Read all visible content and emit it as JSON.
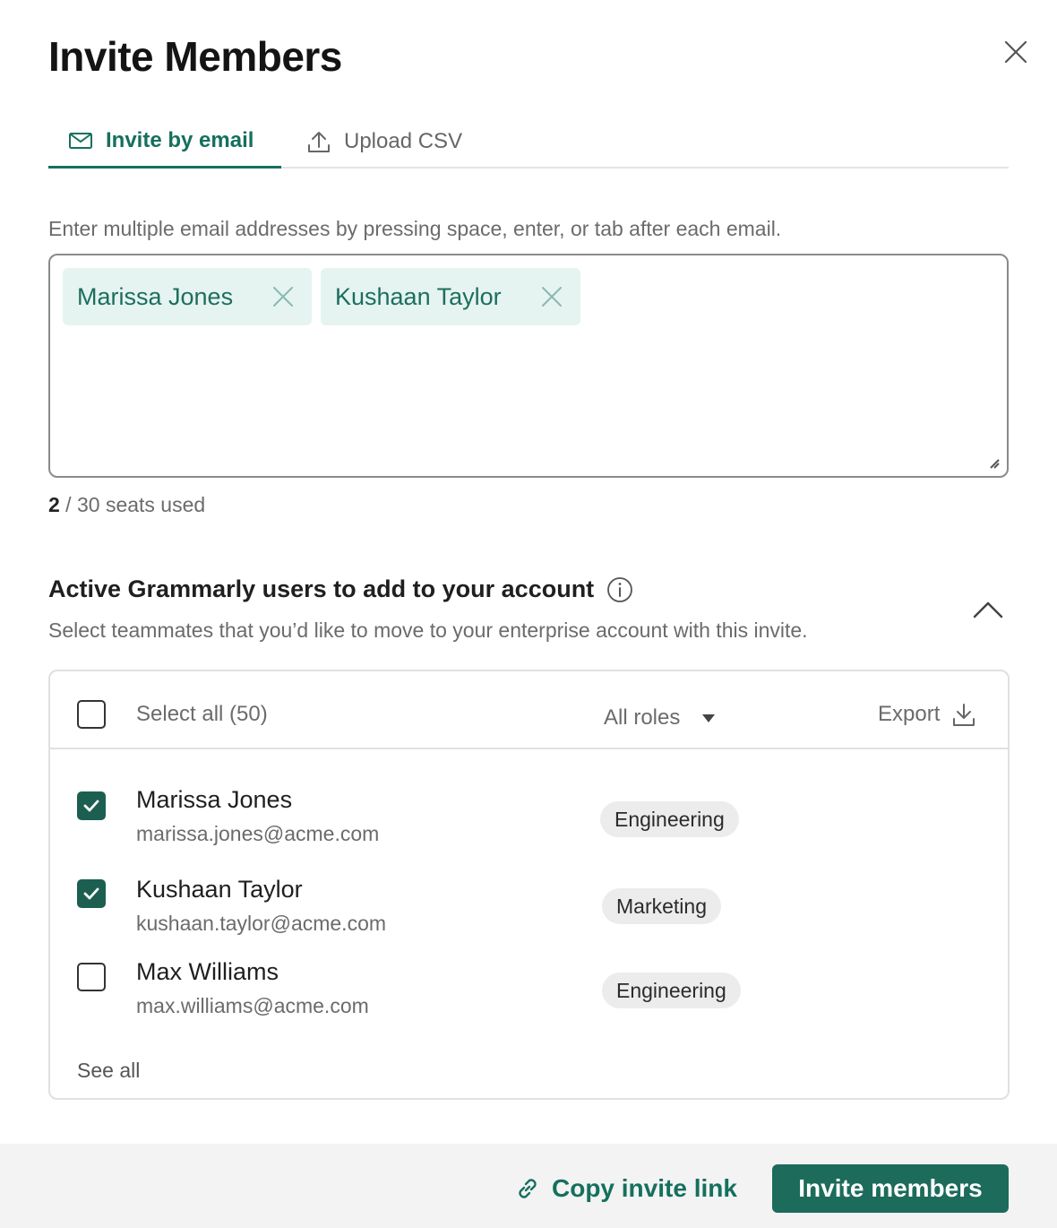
{
  "modal": {
    "title": "Invite Members"
  },
  "tabs": [
    {
      "label": "Invite by email",
      "icon": "mail-icon",
      "active": true
    },
    {
      "label": "Upload CSV",
      "icon": "upload-icon",
      "active": false
    }
  ],
  "email_section": {
    "hint": "Enter multiple email addresses by pressing space, enter, or tab after each email.",
    "chips": [
      {
        "label": "Marissa Jones"
      },
      {
        "label": "Kushaan Taylor"
      }
    ],
    "seats_used": "2",
    "seats_total_text": " / 30 seats used"
  },
  "active_users": {
    "title": "Active Grammarly users to add to your account",
    "subtitle": "Select teammates that you’d like to move to your enterprise account with this invite.",
    "select_all_label": "Select all (50)",
    "roles_filter": "All roles",
    "export_label": "Export",
    "users": [
      {
        "name": "Marissa Jones",
        "email": "marissa.jones@acme.com",
        "role": "Engineering",
        "checked": true
      },
      {
        "name": "Kushaan Taylor",
        "email": "kushaan.taylor@acme.com",
        "role": "Marketing",
        "checked": true
      },
      {
        "name": "Max Williams",
        "email": "max.williams@acme.com",
        "role": "Engineering",
        "checked": false
      }
    ],
    "see_all_label": "See all"
  },
  "footer": {
    "copy_link_label": "Copy invite link",
    "invite_button_label": "Invite members"
  },
  "colors": {
    "accent": "#15705e",
    "button": "#1c6b5b",
    "chip_bg": "#e5f4f1"
  }
}
